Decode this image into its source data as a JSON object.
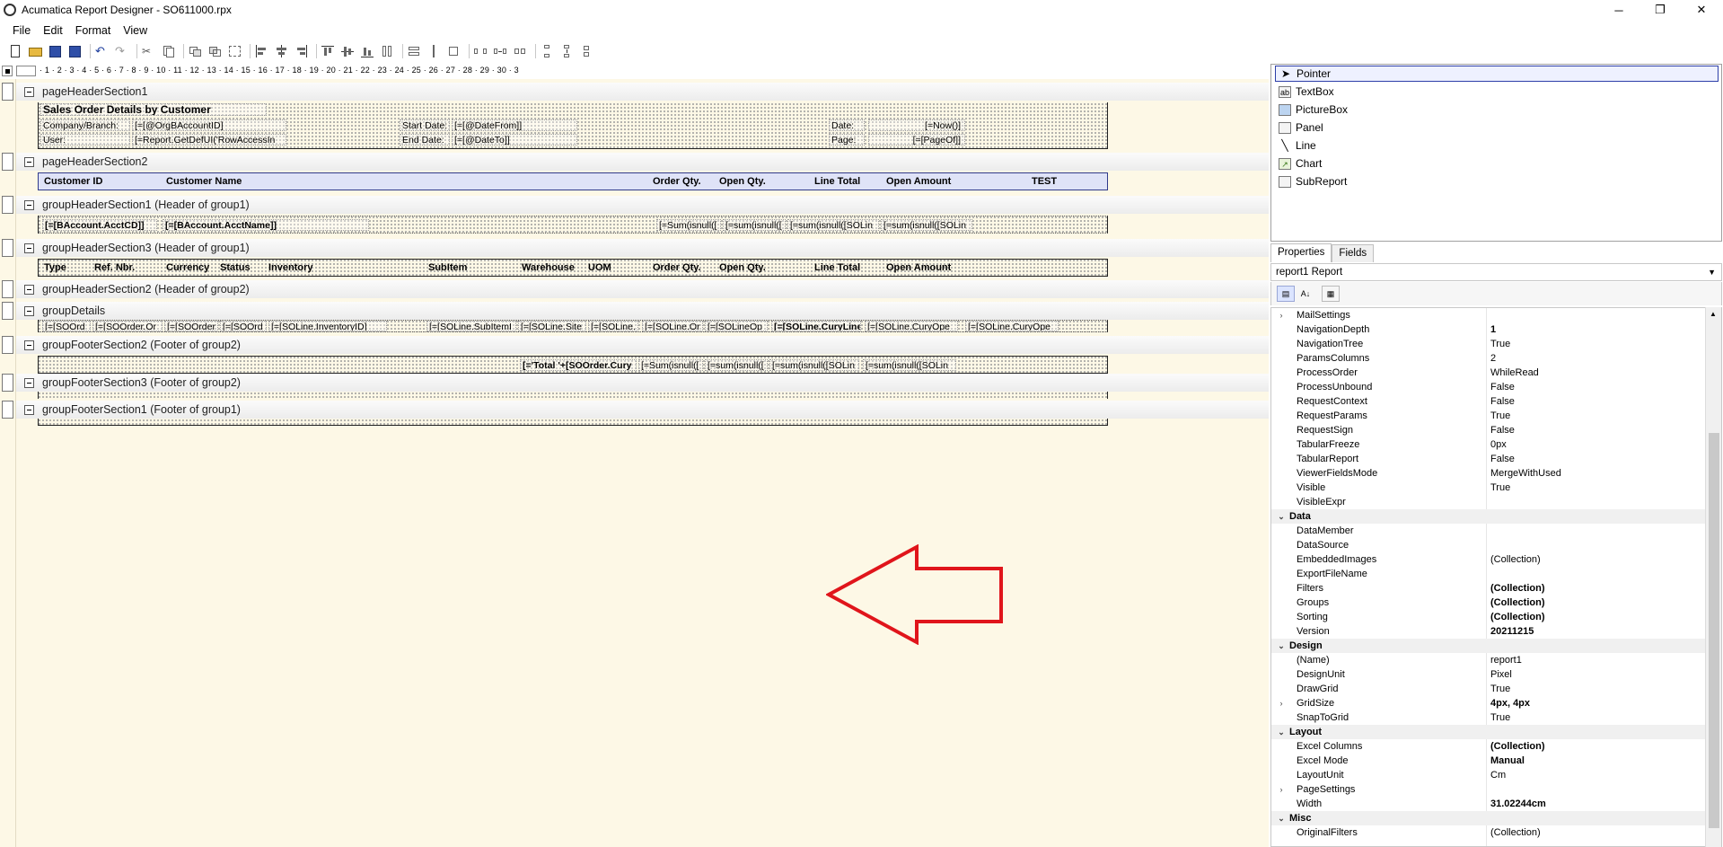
{
  "window": {
    "title": "Acumatica Report Designer - SO611000.rpx",
    "minimize": "─",
    "restore": "❐",
    "close": "✕"
  },
  "menu": [
    "File",
    "Edit",
    "Format",
    "View"
  ],
  "ruler": {
    "labels": "· 1 · 2 · 3 · 4 · 5 · 6 · 7 · 8 · 9 · 10 · 11 · 12 · 13 · 14 · 15 · 16 · 17 · 18 · 19 · 20 · 21 · 22 · 23 · 24 · 25 · 26 · 27 · 28 · 29 · 30 · 3"
  },
  "sections": {
    "pageHeader1": "pageHeaderSection1",
    "pageHeader2": "pageHeaderSection2",
    "groupHeader1": "groupHeaderSection1 (Header of group1)",
    "groupHeader3": "groupHeaderSection3 (Header of group1)",
    "groupHeader2": "groupHeaderSection2 (Header of group2)",
    "details": "groupDetails",
    "groupFooter2": "groupFooterSection2 (Footer of group2)",
    "groupFooter3": "groupFooterSection3 (Footer of group2)",
    "groupFooter1": "groupFooterSection1 (Footer of group1)"
  },
  "pageHeader1": {
    "report_title": "Sales Order Details by Customer",
    "company_label": "Company/Branch:",
    "company_value": "[=[@OrgBAccountID]",
    "user_label": "User:",
    "user_value": "[=Report.GetDefUI('RowAccessIn",
    "start_label": "Start Date:",
    "start_value": "[=[@DateFrom]]",
    "end_label": "End Date:",
    "end_value": "[=[@DateTo]]",
    "date_label": "Date:",
    "date_value": "[=Now()]",
    "page_label": "Page:",
    "page_value": "[=[PageOf]]"
  },
  "pageHeader2": {
    "customer_id": "Customer ID",
    "customer_name": "Customer Name",
    "order_qty": "Order Qty.",
    "open_qty": "Open Qty.",
    "line_total": "Line Total",
    "open_amount": "Open Amount",
    "test": "TEST"
  },
  "groupHeader1": {
    "acct_cd": "[=[BAccount.AcctCD]]",
    "acct_name": "[=[BAccount.AcctName]]",
    "sum1": "[=Sum(isnull([",
    "sum2": "[=sum(isnull([",
    "sum3": "[=sum(isnull([SOLin",
    "sum4": "[=sum(isnull([SOLin"
  },
  "groupHeader3": {
    "type": "Type",
    "ref_nbr": "Ref. Nbr.",
    "currency": "Currency",
    "status": "Status",
    "inventory": "Inventory",
    "subitem": "SubItem",
    "warehouse": "Warehouse",
    "uom": "UOM",
    "order_qty": "Order Qty.",
    "open_qty": "Open Qty.",
    "line_total": "Line Total",
    "open_amount": "Open Amount"
  },
  "details": {
    "f1": "[=[SOOrd",
    "f2": "[=[SOOrder.Or",
    "f3": "[=[SOOrder",
    "f4": "[=[SOOrd",
    "f5": "[=[SOLine.InventoryID]",
    "f6": "[=[SOLine.SubItemI",
    "f7": "[=[SOLine.Site",
    "f8": "[=[SOLine.",
    "f9": "[=[SOLine.Or",
    "f10": "[=[SOLineOp",
    "f11": "[=[SOLine.CuryLine",
    "f12": "[=[SOLine.CuryOpe",
    "f13": "[=[SOLine.CuryOpe"
  },
  "groupFooter2": {
    "total": "[='Total '+[SOOrder.Cury",
    "sum1": "[=Sum(isnull([",
    "sum2": "[=sum(isnull([",
    "sum3": "[=sum(isnull([SOLin",
    "sum4": "[=sum(isnull([SOLin"
  },
  "toolbox": [
    "Pointer",
    "TextBox",
    "PictureBox",
    "Panel",
    "Line",
    "Chart",
    "SubReport"
  ],
  "tabs": [
    "Properties",
    "Fields"
  ],
  "object_selector": "report1 Report",
  "properties": [
    {
      "name": "MailSettings",
      "value": "",
      "exp": true
    },
    {
      "name": "NavigationDepth",
      "value": "1",
      "bold": true
    },
    {
      "name": "NavigationTree",
      "value": "True"
    },
    {
      "name": "ParamsColumns",
      "value": "2"
    },
    {
      "name": "ProcessOrder",
      "value": "WhileRead"
    },
    {
      "name": "ProcessUnbound",
      "value": "False"
    },
    {
      "name": "RequestContext",
      "value": "False"
    },
    {
      "name": "RequestParams",
      "value": "True"
    },
    {
      "name": "RequestSign",
      "value": "False"
    },
    {
      "name": "TabularFreeze",
      "value": "0px"
    },
    {
      "name": "TabularReport",
      "value": "False"
    },
    {
      "name": "ViewerFieldsMode",
      "value": "MergeWithUsed"
    },
    {
      "name": "Visible",
      "value": "True"
    },
    {
      "name": "VisibleExpr",
      "value": ""
    },
    {
      "name": "Data",
      "value": "",
      "cat": true
    },
    {
      "name": "DataMember",
      "value": ""
    },
    {
      "name": "DataSource",
      "value": ""
    },
    {
      "name": "EmbeddedImages",
      "value": "(Collection)"
    },
    {
      "name": "ExportFileName",
      "value": ""
    },
    {
      "name": "Filters",
      "value": "(Collection)",
      "bold": true
    },
    {
      "name": "Groups",
      "value": "(Collection)",
      "bold": true
    },
    {
      "name": "Sorting",
      "value": "(Collection)",
      "bold": true
    },
    {
      "name": "Version",
      "value": "20211215",
      "bold": true
    },
    {
      "name": "Design",
      "value": "",
      "cat": true
    },
    {
      "name": "(Name)",
      "value": "report1"
    },
    {
      "name": "DesignUnit",
      "value": "Pixel"
    },
    {
      "name": "DrawGrid",
      "value": "True"
    },
    {
      "name": "GridSize",
      "value": "4px, 4px",
      "bold": true,
      "exp": true
    },
    {
      "name": "SnapToGrid",
      "value": "True"
    },
    {
      "name": "Layout",
      "value": "",
      "cat": true
    },
    {
      "name": "Excel Columns",
      "value": "(Collection)",
      "bold": true
    },
    {
      "name": "Excel Mode",
      "value": "Manual",
      "bold": true
    },
    {
      "name": "LayoutUnit",
      "value": "Cm"
    },
    {
      "name": "PageSettings",
      "value": "",
      "exp": true
    },
    {
      "name": "Width",
      "value": "31.02244cm",
      "bold": true
    },
    {
      "name": "Misc",
      "value": "",
      "cat": true
    },
    {
      "name": "OriginalFilters",
      "value": "(Collection)"
    }
  ],
  "colors": {
    "surface": "#fdf8e6",
    "arrow": "#e0151b",
    "selection": "#2d3fa8"
  }
}
